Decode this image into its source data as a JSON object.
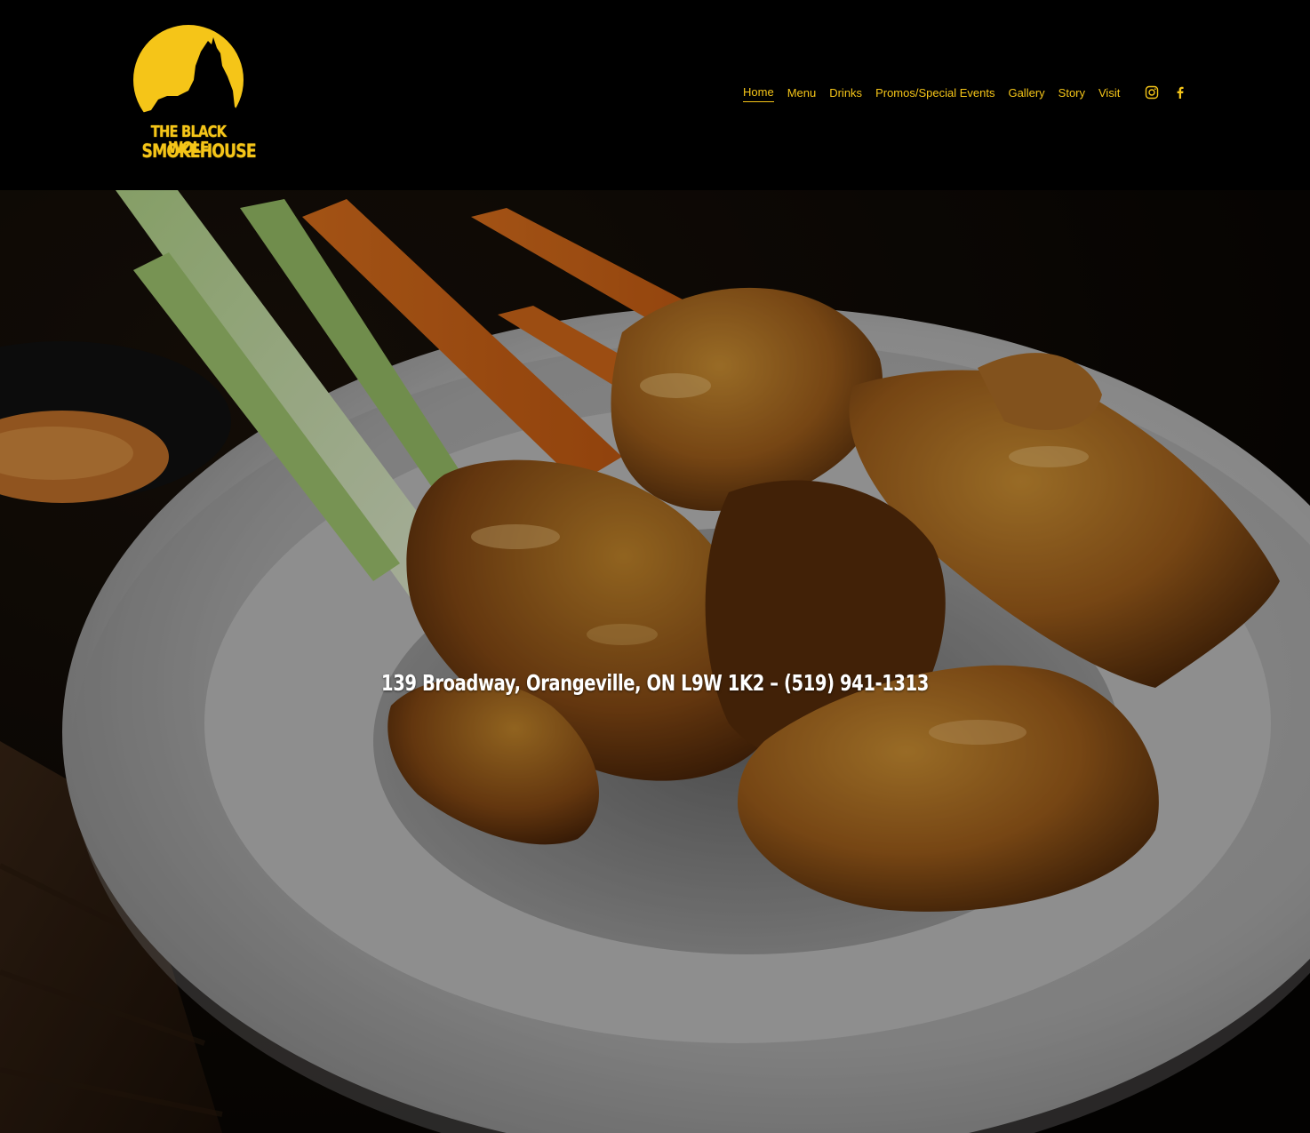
{
  "brand": {
    "name_line1": "THE BLACK WOLF",
    "name_line2": "SMOKEHOUSE",
    "logo_icon": "howling-wolf-moon-icon",
    "accent_color": "#f5c518"
  },
  "nav": {
    "items": [
      {
        "label": "Home",
        "active": true
      },
      {
        "label": "Menu"
      },
      {
        "label": "Drinks"
      },
      {
        "label": "Promos/Special Events"
      },
      {
        "label": "Gallery"
      },
      {
        "label": "Story"
      },
      {
        "label": "Visit"
      }
    ]
  },
  "social": {
    "icons": [
      "instagram-icon",
      "facebook-icon"
    ]
  },
  "hero": {
    "image": "chicken-wings-with-celery-carrots-and-dip",
    "address_line": "139 Broadway, Orangeville, ON L9W 1K2 – (519) 941-1313"
  }
}
